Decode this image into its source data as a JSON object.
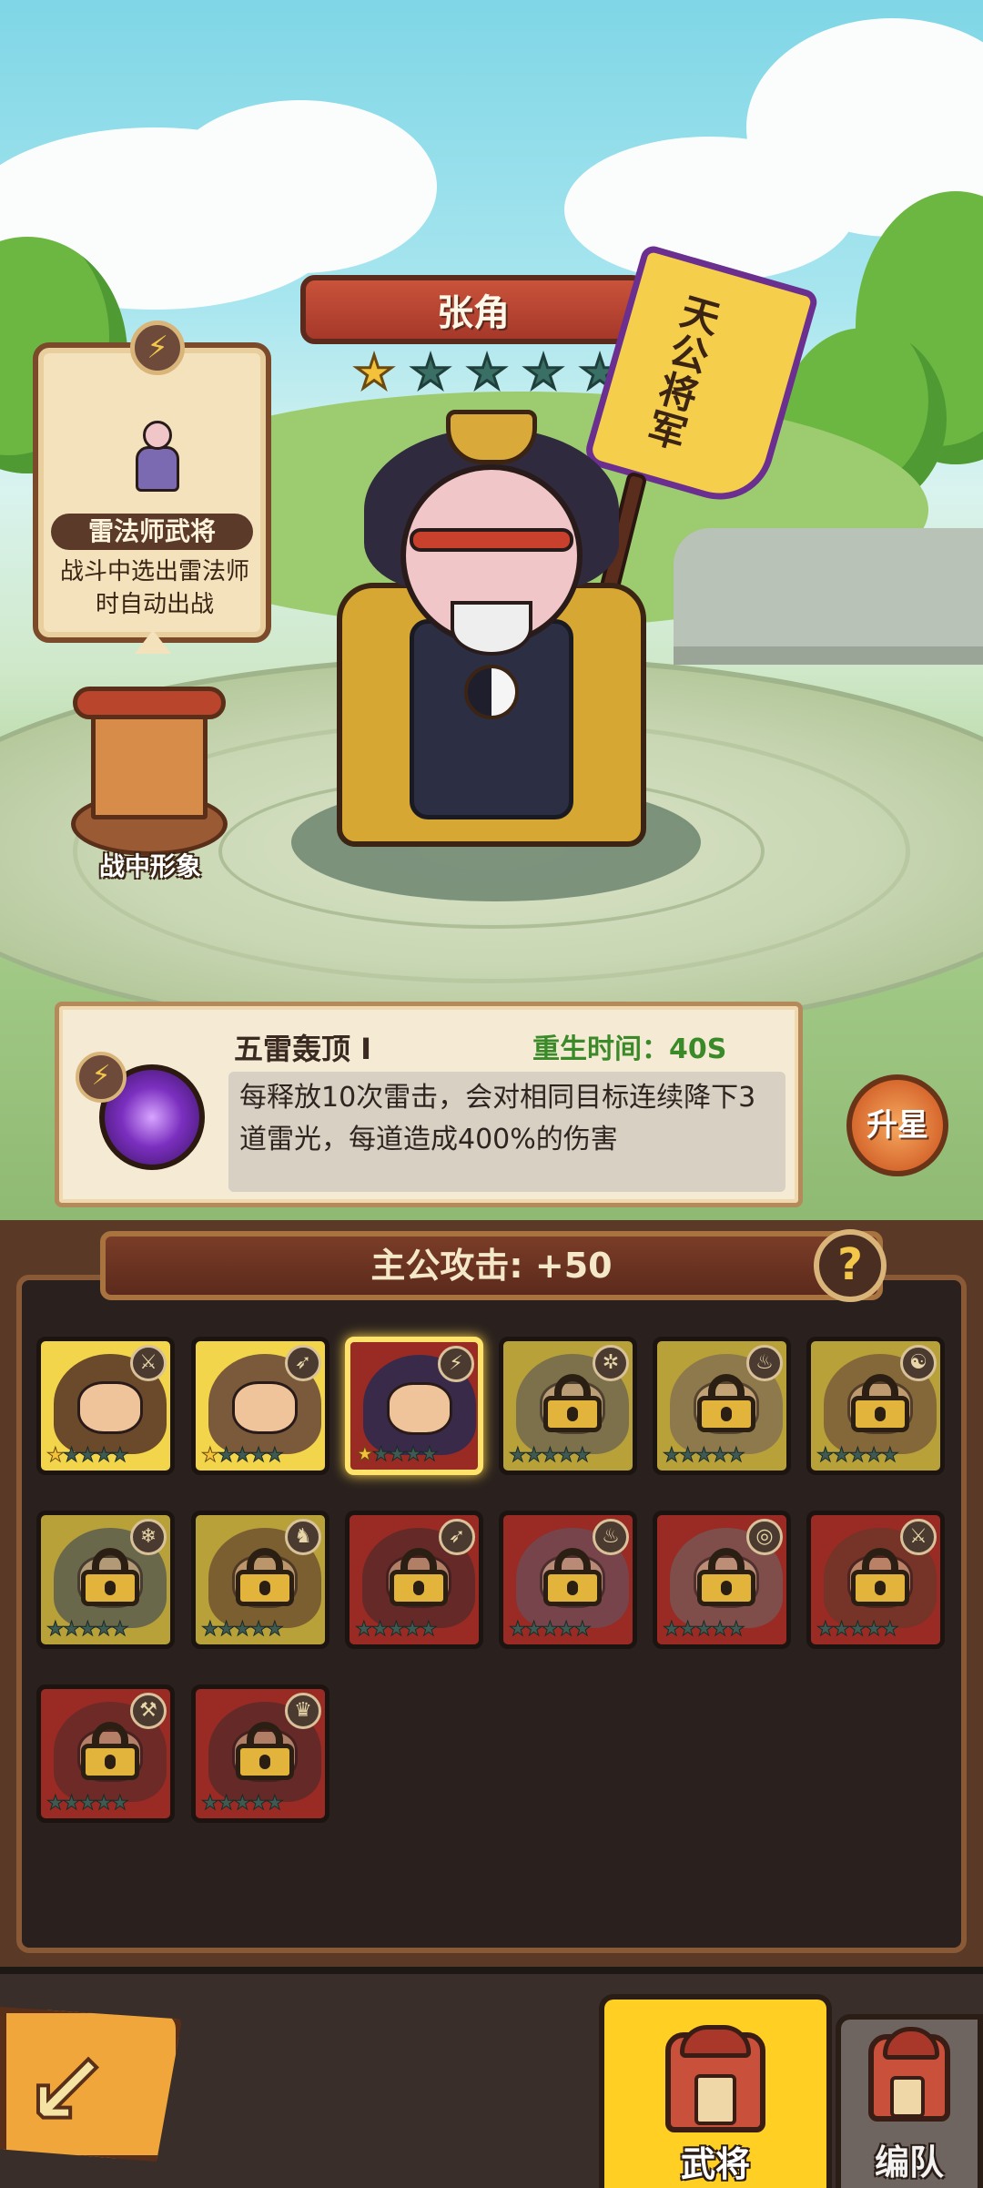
{
  "hero": {
    "name": "张角",
    "stars_total": 5,
    "stars_filled": 1,
    "flag_text": "天公将军"
  },
  "class_card": {
    "icon": "lightning-icon",
    "title": "雷法师武将",
    "description": "战斗中选出雷法师时自动出战"
  },
  "battle_appearance": {
    "label": "战中形象"
  },
  "skill": {
    "icon": "lightning-icon",
    "name": "五雷轰顶 Ⅰ",
    "cooldown": "重生时间：40S",
    "description": "每释放10次雷击，会对相同目标连续降下3道雷光，每道造成400%的伤害"
  },
  "star_up_button": "升星",
  "lord_attack": "主公攻击: +50",
  "help_button": "?",
  "heroes": [
    {
      "locked": false,
      "style": "unlocked",
      "type_icon": "sword-icon",
      "stars": 1,
      "selected": false
    },
    {
      "locked": false,
      "style": "unlocked",
      "type_icon": "bow-icon",
      "stars": 1,
      "selected": false
    },
    {
      "locked": false,
      "style": "red",
      "type_icon": "lightning-icon",
      "stars": 1,
      "selected": true
    },
    {
      "locked": true,
      "style": "gold",
      "type_icon": "gear-icon",
      "stars": 0,
      "selected": false
    },
    {
      "locked": true,
      "style": "gold",
      "type_icon": "fire-icon",
      "stars": 0,
      "selected": false
    },
    {
      "locked": true,
      "style": "gold",
      "type_icon": "dragon-icon",
      "stars": 0,
      "selected": false
    },
    {
      "locked": true,
      "style": "gold",
      "type_icon": "snowflake-icon",
      "stars": 0,
      "selected": false
    },
    {
      "locked": true,
      "style": "gold",
      "type_icon": "horse-icon",
      "stars": 0,
      "selected": false
    },
    {
      "locked": true,
      "style": "red",
      "type_icon": "bow-icon",
      "stars": 0,
      "selected": false
    },
    {
      "locked": true,
      "style": "red",
      "type_icon": "fire-icon",
      "stars": 0,
      "selected": false
    },
    {
      "locked": true,
      "style": "red",
      "type_icon": "swirl-icon",
      "stars": 0,
      "selected": false
    },
    {
      "locked": true,
      "style": "red",
      "type_icon": "sword-icon",
      "stars": 0,
      "selected": false
    },
    {
      "locked": true,
      "style": "red",
      "type_icon": "axe-icon",
      "stars": 0,
      "selected": false
    },
    {
      "locked": true,
      "style": "red",
      "type_icon": "tiger-icon",
      "stars": 0,
      "selected": false
    }
  ],
  "footer": {
    "back_icon": "back-arrow-icon",
    "tab_generals": "武将",
    "tab_team": "编队"
  }
}
